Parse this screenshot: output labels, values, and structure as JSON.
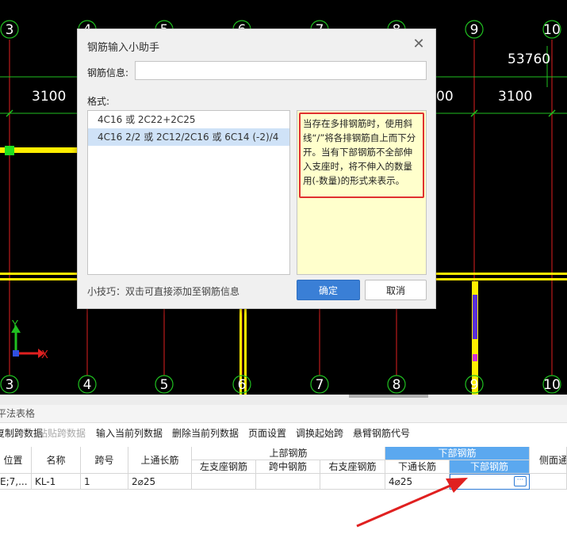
{
  "cad": {
    "top_axes": [
      "3",
      "4",
      "5",
      "6",
      "7",
      "8",
      "9",
      "10"
    ],
    "bottom_axes": [
      "3",
      "4",
      "5",
      "6",
      "7",
      "8",
      "9",
      "10"
    ],
    "dim_left": "3100",
    "dim_mid": "00",
    "dim_right": "3100",
    "dim_total": "53760",
    "ucs_y": "Y",
    "ucs_x": "X"
  },
  "dialog": {
    "title": "钢筋输入小助手",
    "close_glyph": "✕",
    "info_label": "钢筋信息:",
    "info_value": "",
    "format_label": "格式:",
    "formats": [
      "4C16 或 2C22+2C25",
      "4C16 2/2 或 2C12/2C16 或 6C14 (-2)/4"
    ],
    "selected_format": 1,
    "description": "当存在多排钢筋时，使用斜线“/”将各排钢筋自上而下分开。当有下部钢筋不全部伸入支座时，将不伸入的数量用(-数量)的形式来表示。",
    "tip": "小技巧：双击可直接添加至钢筋信息",
    "ok_label": "确定",
    "cancel_label": "取消"
  },
  "panel": {
    "title": "平法表格",
    "toolbar": [
      {
        "label": "复制跨数据",
        "enabled": true
      },
      {
        "label": "粘贴跨数据",
        "enabled": false
      },
      {
        "label": "输入当前列数据",
        "enabled": true
      },
      {
        "label": "删除当前列数据",
        "enabled": true
      },
      {
        "label": "页面设置",
        "enabled": true
      },
      {
        "label": "调换起始跨",
        "enabled": true
      },
      {
        "label": "悬臂钢筋代号",
        "enabled": true
      }
    ],
    "headers": {
      "position": "位置",
      "name": "名称",
      "span": "跨号",
      "top_long": "上通长筋",
      "upper_group": "上部钢筋",
      "left_support": "左支座钢筋",
      "mid_span": "跨中钢筋",
      "right_support": "右支座钢筋",
      "lower_group": "下部钢筋",
      "bottom_long": "下通长筋",
      "bottom_bar": "下部钢筋",
      "side": "侧面通"
    },
    "row": {
      "position": "E;7,...",
      "name": "KL-1",
      "span": "1",
      "top_long": "2⌀25",
      "left_support": "",
      "mid_span": "",
      "right_support": "",
      "bottom_long": "4⌀25",
      "bottom_bar": "",
      "side": ""
    },
    "more_glyph": "···"
  },
  "colors": {
    "cad_background": "#000000",
    "grid_line": "#e02020",
    "dim_line": "#20c020",
    "beam": "#ffee00",
    "accent_blue": "#3a7fd6",
    "header_blue": "#5ba8ef",
    "annotation_red": "#e02020"
  }
}
